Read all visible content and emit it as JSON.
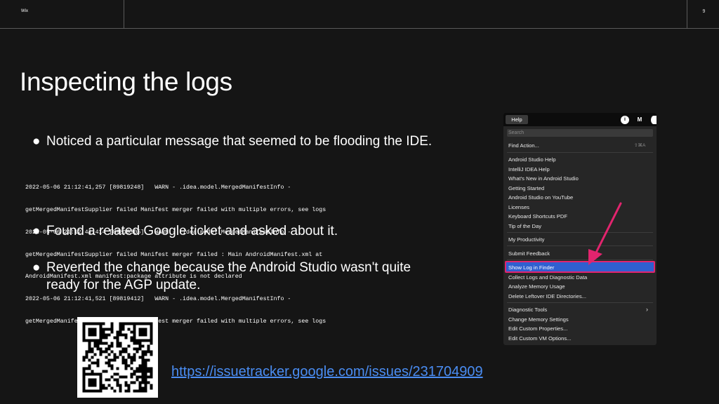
{
  "header": {
    "brand": "Wix",
    "page_number": "9"
  },
  "title": "Inspecting the logs",
  "bullets": [
    "Noticed a particular message that seemed to be flooding the IDE.",
    "Found a related Google ticket and asked about it.",
    "Reverted the change because the Android Studio wasn't quite",
    "ready for the AGP update."
  ],
  "bullet_glyph": "●",
  "log_lines": [
    "2022-05-06 21:12:41,257 [89819248]   WARN - .idea.model.MergedManifestInfo -",
    "getMergedManifestSupplier failed Manifest merger failed with multiple errors, see logs",
    "2022-05-06 21:12:41,414 [89819305]   WARN - .idea.model.MergedManifestInfo -",
    "getMergedManifestSupplier failed Manifest merger failed : Main AndroidManifest.xml at",
    "AndroidManifest.xml manifest:package attribute is not declared",
    "2022-05-06 21:12:41,521 [89819412]   WARN - .idea.model.MergedManifestInfo -",
    "getMergedManifestSupplier failed Manifest merger failed with multiple errors, see logs"
  ],
  "link": "https://issuetracker.google.com/issues/231704909",
  "menu": {
    "bar_label": "Help",
    "search_placeholder": "Search",
    "find_action": "Find Action...",
    "find_action_shortcut": "⇧⌘A",
    "group1": [
      "Android Studio Help",
      "IntelliJ IDEA Help",
      "What's New in Android Studio",
      "Getting Started",
      "Android Studio on YouTube",
      "Licenses",
      "Keyboard Shortcuts PDF",
      "Tip of the Day"
    ],
    "my_productivity": "My Productivity",
    "submit_feedback": "Submit Feedback",
    "group2": [
      "Show Log in Finder",
      "Collect Logs and Diagnostic Data",
      "Analyze Memory Usage",
      "Delete Leftover IDE Directories..."
    ],
    "group3": [
      "Diagnostic Tools",
      "Change Memory Settings",
      "Edit Custom Properties...",
      "Edit Custom VM Options..."
    ],
    "submenu_arrow": "›",
    "status_icons": [
      "i",
      "M"
    ]
  },
  "colors": {
    "accent": "#2f5fd0",
    "highlight_border": "#e2246e",
    "link": "#4a8df3"
  }
}
